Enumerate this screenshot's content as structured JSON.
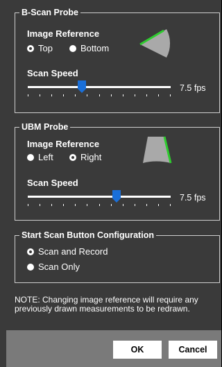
{
  "bscan": {
    "title": "B-Scan Probe",
    "image_reference_label": "Image Reference",
    "options": [
      {
        "label": "Top",
        "selected": true
      },
      {
        "label": "Bottom",
        "selected": false
      }
    ],
    "scan_speed_label": "Scan Speed",
    "speed_value": "7.5 fps",
    "slider_fraction": 0.38
  },
  "ubm": {
    "title": "UBM Probe",
    "image_reference_label": "Image Reference",
    "options": [
      {
        "label": "Left",
        "selected": false
      },
      {
        "label": "Right",
        "selected": true
      }
    ],
    "scan_speed_label": "Scan Speed",
    "speed_value": "7.5 fps",
    "slider_fraction": 0.62
  },
  "start_scan": {
    "title": "Start Scan Button Configuration",
    "options": [
      {
        "label": "Scan and Record",
        "selected": true
      },
      {
        "label": "Scan Only",
        "selected": false
      }
    ]
  },
  "note": "NOTE:  Changing image reference will require any previously drawn measurements to be redrawn.",
  "buttons": {
    "ok": "OK",
    "cancel": "Cancel"
  },
  "colors": {
    "background": "#3a3a3a",
    "footer": "#7a7a7a",
    "slider_thumb": "#1a6fd8",
    "probe_fill": "#a9a9a9",
    "probe_edge": "#2ecc2e"
  }
}
